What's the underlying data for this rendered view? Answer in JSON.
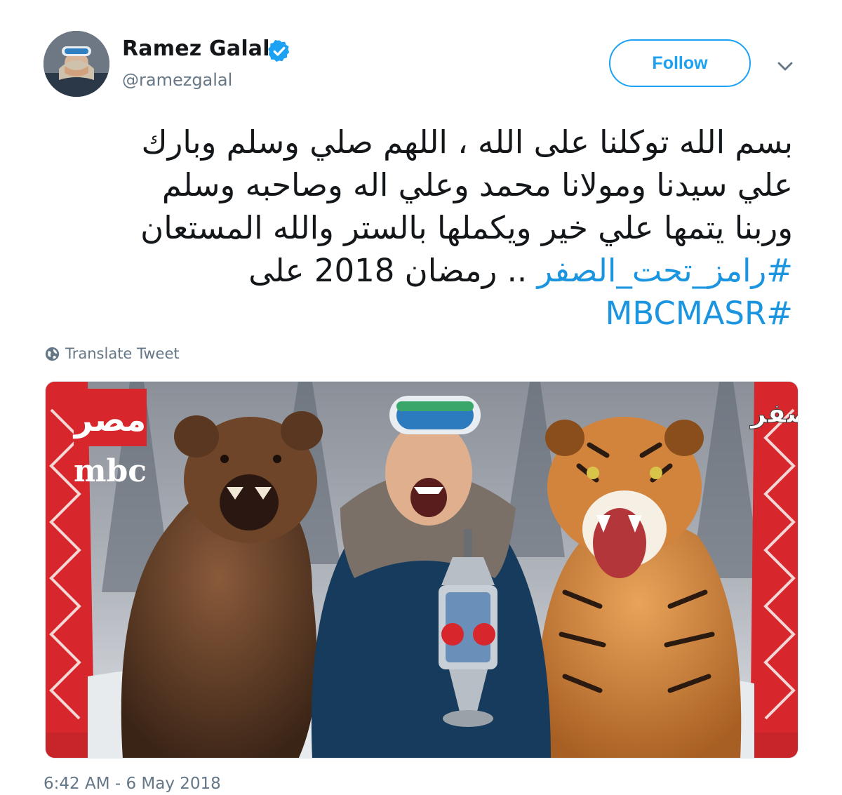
{
  "author": {
    "name": "Ramez Galal",
    "handle": "@ramezgalal",
    "verified": true
  },
  "actions": {
    "follow_label": "Follow"
  },
  "tweet": {
    "lines": [
      "بسم الله توكلنا على الله ، اللهم صلي وسلم وبارك",
      "علي سيدنا ومولانا محمد وعلي اله وصاحبه وسلم",
      "وربنا يتمها علي خير ويكملها بالستر والله المستعان"
    ],
    "hashtag_ramez": "#رامز_تحت_الصفر",
    "ramadan_text": ".. رمضان 2018 على",
    "hashtag_mbc": "#MBCMASR",
    "translate_label": "Translate Tweet",
    "timestamp": "6:42 AM - 6 May 2018"
  },
  "media": {
    "logo_arabic": "مصر",
    "logo_latin": "mbc",
    "show_title": "رامز تحت الصفر"
  },
  "colors": {
    "twitter_blue": "#1da1f2",
    "hashtag_blue": "#1b95e0",
    "secondary_text": "#657786",
    "verified_blue": "#1da1f2",
    "mbc_red": "#d7262c"
  },
  "icons": {
    "verified": "verified-badge-icon",
    "caret": "chevron-down-icon",
    "globe": "globe-icon"
  }
}
